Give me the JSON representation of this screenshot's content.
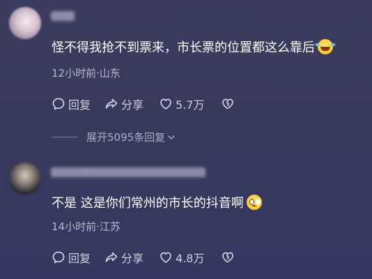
{
  "comments": [
    {
      "text": "怪不得我抢不到票来，市长票的位置都这么靠后",
      "emoji": "rolling-on-floor-laughing-emoji",
      "meta": "12小时前·山东",
      "reply_label": "回复",
      "share_label": "分享",
      "like_count": "5.7万"
    },
    {
      "text": "不是 这是你们常州的市长的抖音啊",
      "emoji": "pleading-face-emoji",
      "meta": "14小时前·江苏",
      "reply_label": "回复",
      "share_label": "分享",
      "like_count": "4.8万"
    }
  ],
  "expand_replies": "展开5095条回复"
}
